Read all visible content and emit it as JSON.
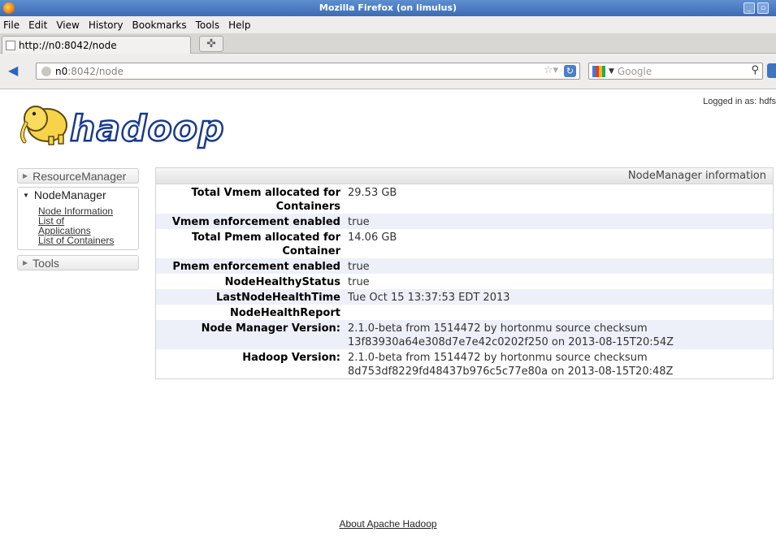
{
  "window": {
    "title": "Mozilla Firefox (on limulus)"
  },
  "menu": [
    "File",
    "Edit",
    "View",
    "History",
    "Bookmarks",
    "Tools",
    "Help"
  ],
  "tab": {
    "title": "http://n0:8042/node"
  },
  "nav": {
    "url_host": "n0",
    "url_path": ":8042/node",
    "search_placeholder": "Google"
  },
  "page": {
    "logged_in": "Logged in as: hdfs",
    "logo_text": "hadoop",
    "sidebar": {
      "resourcemanager": "ResourceManager",
      "nodemanager": "NodeManager",
      "links": [
        "Node Information",
        "List of Applications",
        "List of Containers"
      ],
      "tools": "Tools"
    },
    "panel_title": "NodeManager information",
    "rows": [
      {
        "label": "Total Vmem allocated for Containers",
        "value": "29.53 GB"
      },
      {
        "label": "Vmem enforcement enabled",
        "value": "true"
      },
      {
        "label": "Total Pmem allocated for Container",
        "value": "14.06 GB"
      },
      {
        "label": "Pmem enforcement enabled",
        "value": "true"
      },
      {
        "label": "NodeHealthyStatus",
        "value": "true"
      },
      {
        "label": "LastNodeHealthTime",
        "value": "Tue Oct 15 13:37:53 EDT 2013"
      },
      {
        "label": "NodeHealthReport",
        "value": ""
      },
      {
        "label": "Node Manager Version:",
        "value": "2.1.0-beta from 1514472 by hortonmu source checksum 13f83930a64e308d7e7e42c0202f250 on 2013-08-15T20:54Z"
      },
      {
        "label": "Hadoop Version:",
        "value": "2.1.0-beta from 1514472 by hortonmu source checksum 8d753df8229fd48437b976c5c77e80a on 2013-08-15T20:48Z"
      }
    ],
    "footer_link": "About Apache Hadoop"
  }
}
